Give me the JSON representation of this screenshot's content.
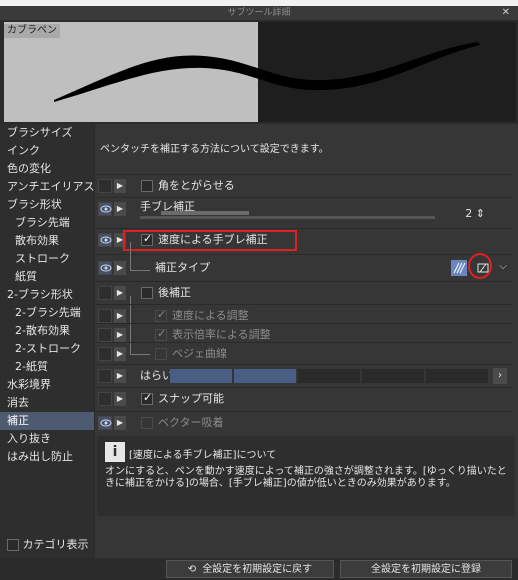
{
  "window": {
    "title": "サブツール詳細",
    "close_icon": "close-icon"
  },
  "preview": {
    "label": "カブラペン"
  },
  "sidebar": {
    "items": [
      {
        "label": "ブラシサイズ",
        "indent": false
      },
      {
        "label": "インク",
        "indent": false
      },
      {
        "label": "色の変化",
        "indent": false
      },
      {
        "label": "アンチエイリアス",
        "indent": false
      },
      {
        "label": "ブラシ形状",
        "indent": false
      },
      {
        "label": "ブラシ先端",
        "indent": true
      },
      {
        "label": "散布効果",
        "indent": true
      },
      {
        "label": "ストローク",
        "indent": true
      },
      {
        "label": "紙質",
        "indent": true
      },
      {
        "label": "2-ブラシ形状",
        "indent": false
      },
      {
        "label": "2-ブラシ先端",
        "indent": true
      },
      {
        "label": "2-散布効果",
        "indent": true
      },
      {
        "label": "2-ストローク",
        "indent": true
      },
      {
        "label": "2-紙質",
        "indent": true
      },
      {
        "label": "水彩境界",
        "indent": false
      },
      {
        "label": "消去",
        "indent": false
      },
      {
        "label": "補正",
        "indent": false,
        "selected": true
      },
      {
        "label": "入り抜き",
        "indent": false
      },
      {
        "label": "はみ出し防止",
        "indent": false
      }
    ],
    "category_toggle": "カテゴリ表示"
  },
  "main": {
    "description": "ペンタッチを補正する方法について設定できます。",
    "rows": {
      "sharpen": "角をとがらせる",
      "stabilization": "手ブレ補正",
      "stabilization_value": "2",
      "speed_stabilization": "速度による手ブレ補正",
      "correction_type": "補正タイプ",
      "post_correction": "後補正",
      "speed_adjust": "速度による調整",
      "zoom_adjust": "表示倍率による調整",
      "bezier": "ベジェ曲線",
      "sweep": "はらい",
      "snap": "スナップ可能",
      "vector_snap": "ベクター吸着"
    },
    "info": {
      "title": "[速度による手ブレ補正]について",
      "body": "オンにすると、ペンを動かす速度によって補正の強さが調整されます。[ゆっくり描いたときに補正をかける]の場合、[手ブレ補正]の値が低いときのみ効果があります。"
    }
  },
  "buttons": {
    "reset_all": "全設定を初期設定に戻す",
    "register_all": "全設定を初期設定に登録"
  },
  "colors": {
    "accent": "#4d5a70",
    "highlight": "#e02020",
    "selected_type": "#6a86c0"
  }
}
